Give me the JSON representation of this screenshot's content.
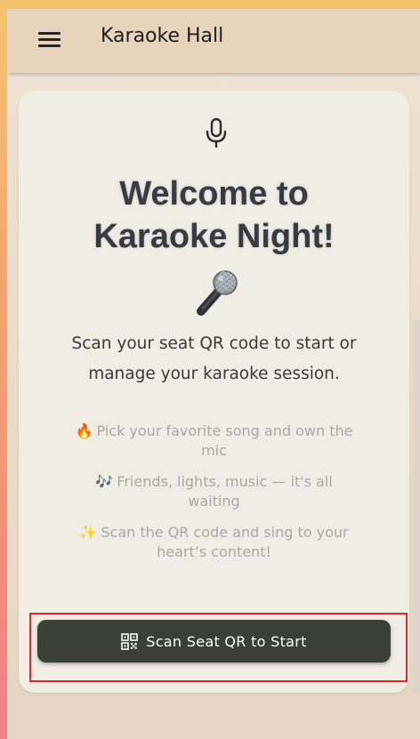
{
  "app_bar": {
    "menu_icon": "hamburger-menu-icon",
    "title": "Karaoke Hall"
  },
  "welcome_card": {
    "top_icon": "microphone-outline-icon",
    "title_line1": "Welcome to",
    "title_line2": "Karaoke Night!",
    "title_emoji_icon": "microphone-emoji-icon",
    "intro_text": "Scan your seat QR code to start or manage your karaoke session.",
    "features": [
      {
        "icon": "🔥",
        "text": "Pick your favorite song and own the mic"
      },
      {
        "icon": "🎶",
        "text": "Friends, lights, music — it's all waiting"
      },
      {
        "icon": "✨",
        "text": "Scan the QR code and sing to your heart’s content!"
      }
    ],
    "scan_button": {
      "icon": "qr-code-icon",
      "label": "Scan Seat QR to Start"
    }
  },
  "colors": {
    "app_bar_background": "#e8d4bb",
    "card_background": "#efede4",
    "button_background": "#3a4037",
    "title_text": "#383b40",
    "feature_text": "#a8a9a6",
    "highlight_border": "#e0272d"
  }
}
